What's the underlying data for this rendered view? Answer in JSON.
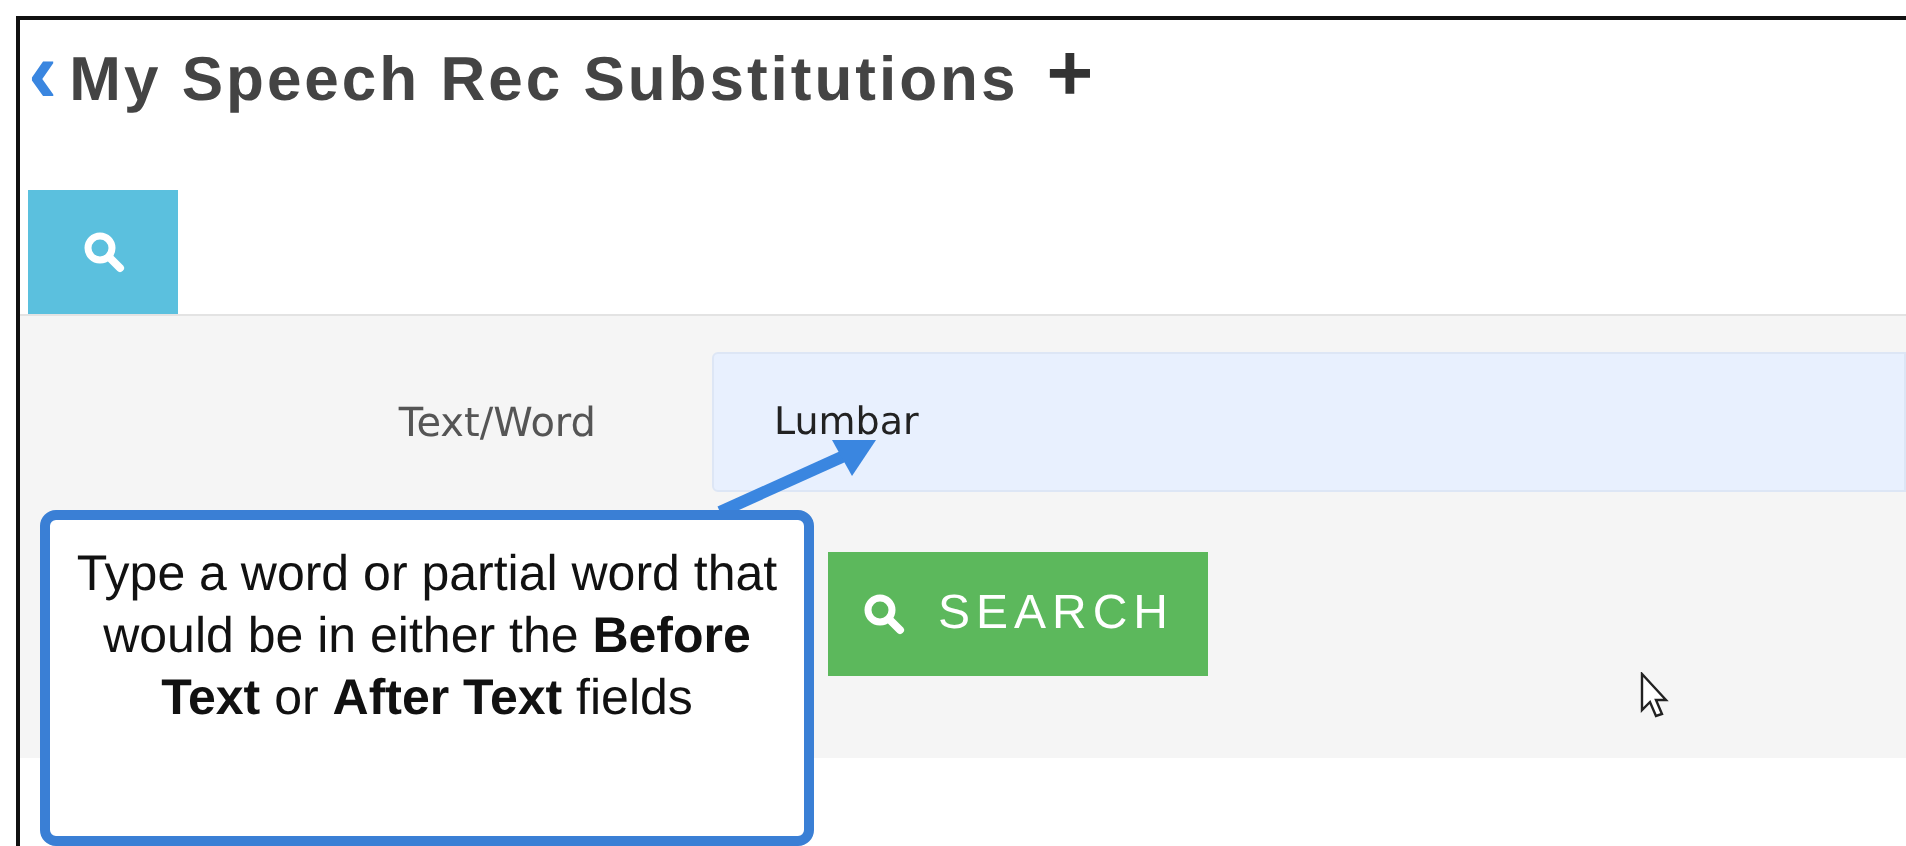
{
  "header": {
    "back": "‹",
    "title": "My Speech Rec Substitutions",
    "add": "+"
  },
  "tabs": [
    {
      "kind": "search",
      "selected": true
    }
  ],
  "form": {
    "label": "Text/Word",
    "value": "Lumbar",
    "button": "SEARCH"
  },
  "callout": {
    "text": "Type a word or partial word that would be in either the **Before Text** or **After Text** fields"
  }
}
